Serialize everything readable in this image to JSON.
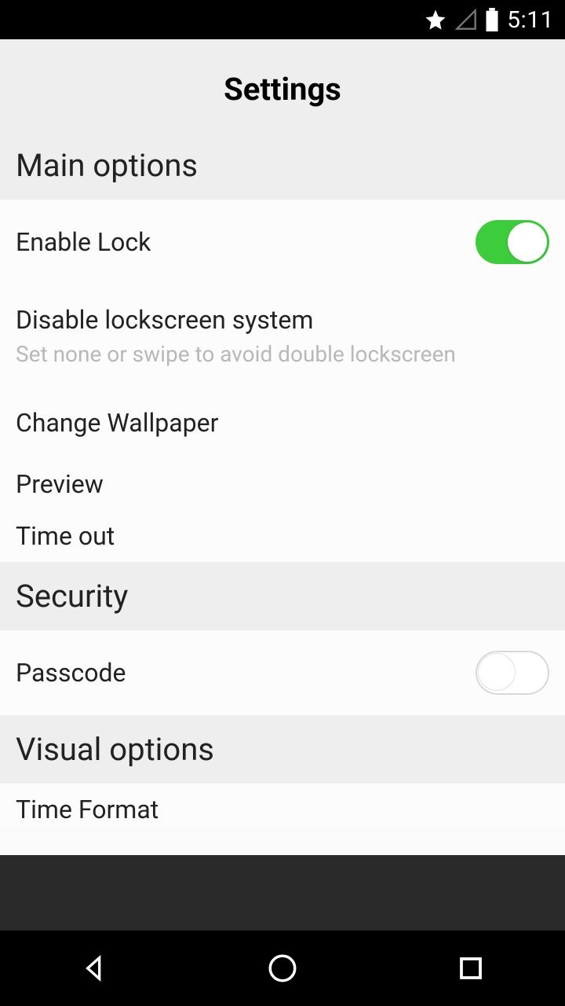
{
  "status": {
    "time": "5:11"
  },
  "header": {
    "title": "Settings"
  },
  "sections": {
    "main": {
      "title": "Main options",
      "enableLock": {
        "label": "Enable Lock",
        "on": true
      },
      "disableLockscreen": {
        "label": "Disable lockscreen system",
        "sub": "Set none or swipe to avoid double lockscreen"
      },
      "changeWallpaper": {
        "label": "Change Wallpaper"
      },
      "preview": {
        "label": "Preview"
      },
      "timeout": {
        "label": "Time out"
      }
    },
    "security": {
      "title": "Security",
      "passcode": {
        "label": "Passcode",
        "on": false
      }
    },
    "visual": {
      "title": "Visual options",
      "timeFormat": {
        "label": "Time Format"
      }
    }
  }
}
